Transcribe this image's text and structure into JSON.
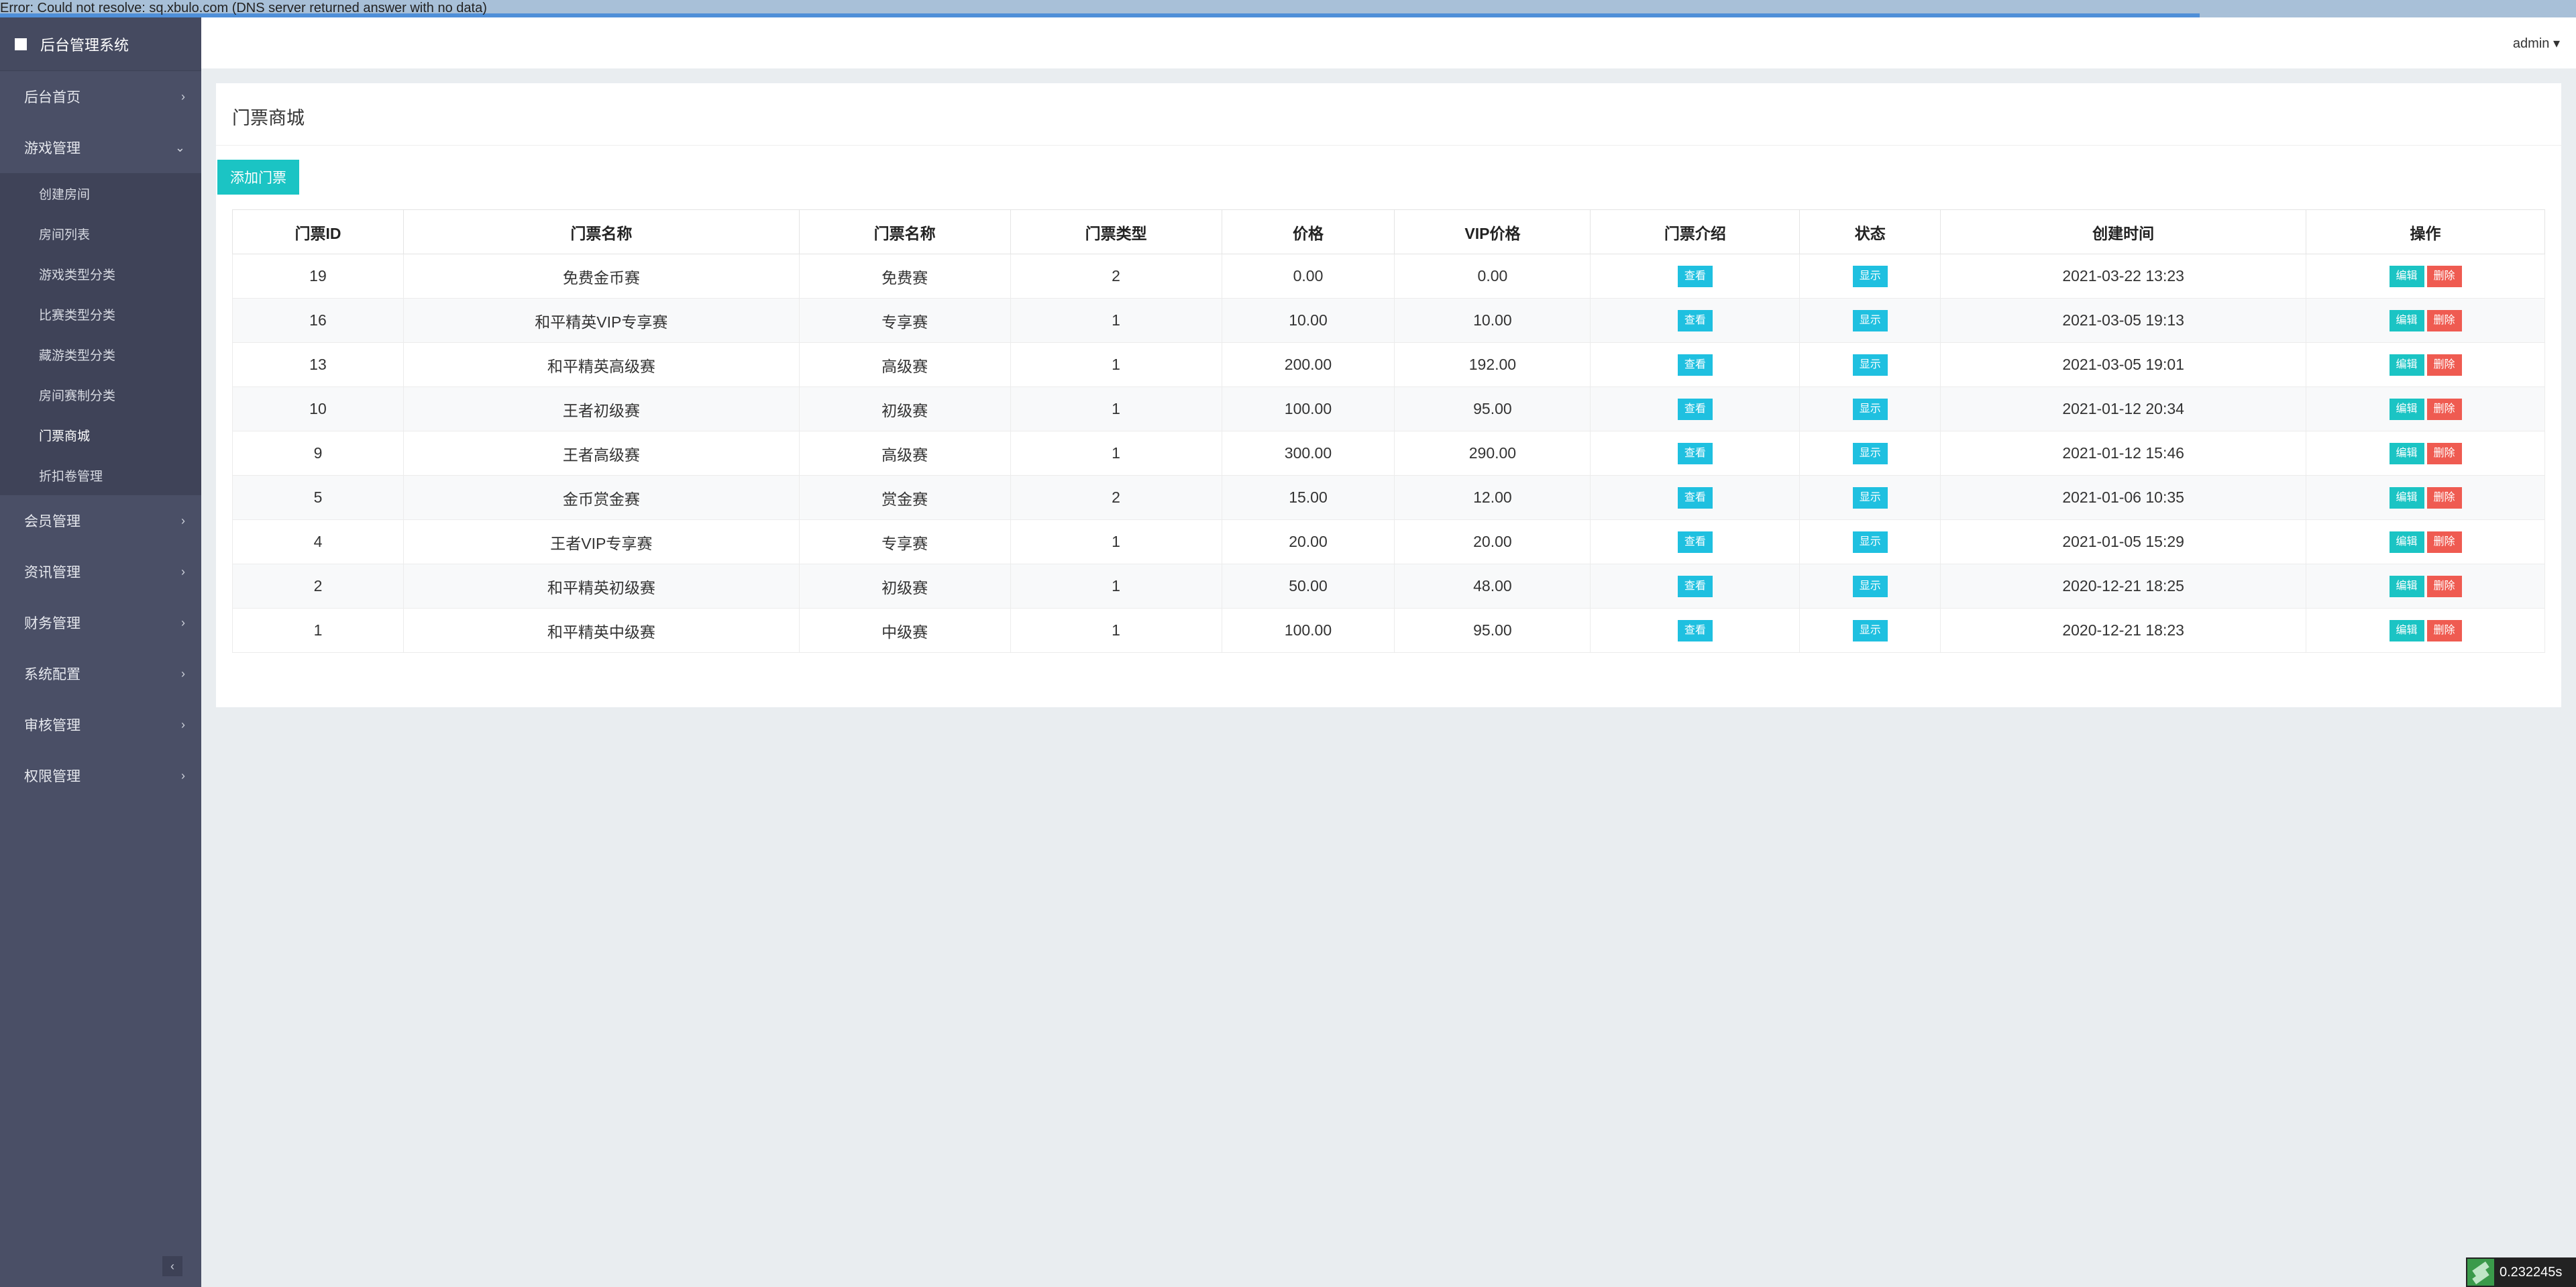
{
  "error_bar": {
    "text": "Error: Could not resolve: sq.xbulo.com (DNS server returned answer with no data)",
    "progress": 0.854
  },
  "brand": {
    "title": "后台管理系统"
  },
  "sidebar": {
    "items": [
      {
        "label": "后台首页",
        "chevron": "›"
      },
      {
        "label": "游戏管理",
        "chevron": "⌄"
      },
      {
        "label": "会员管理",
        "chevron": "›"
      },
      {
        "label": "资讯管理",
        "chevron": "›"
      },
      {
        "label": "财务管理",
        "chevron": "›"
      },
      {
        "label": "系统配置",
        "chevron": "›"
      },
      {
        "label": "审核管理",
        "chevron": "›"
      },
      {
        "label": "权限管理",
        "chevron": "›"
      }
    ],
    "game_submenu": [
      "创建房间",
      "房间列表",
      "游戏类型分类",
      "比赛类型分类",
      "藏游类型分类",
      "房间赛制分类",
      "门票商城",
      "折扣卷管理"
    ],
    "collapse_glyph": "‹"
  },
  "header": {
    "user": "admin ▾"
  },
  "panel": {
    "title": "门票商城",
    "add_button": "添加门票"
  },
  "table": {
    "headers": [
      "门票ID",
      "门票名称",
      "门票名称",
      "门票类型",
      "价格",
      "VIP价格",
      "门票介绍",
      "状态",
      "创建时间",
      "操作"
    ],
    "view_label": "查看",
    "status_label": "显示",
    "edit_label": "编辑",
    "delete_label": "删除",
    "rows": [
      {
        "id": "19",
        "name": "免费金币赛",
        "tier": "免费赛",
        "type": "2",
        "price": "0.00",
        "vip": "0.00",
        "created": "2021-03-22 13:23"
      },
      {
        "id": "16",
        "name": "和平精英VIP专享赛",
        "tier": "专享赛",
        "type": "1",
        "price": "10.00",
        "vip": "10.00",
        "created": "2021-03-05 19:13"
      },
      {
        "id": "13",
        "name": "和平精英高级赛",
        "tier": "高级赛",
        "type": "1",
        "price": "200.00",
        "vip": "192.00",
        "created": "2021-03-05 19:01"
      },
      {
        "id": "10",
        "name": "王者初级赛",
        "tier": "初级赛",
        "type": "1",
        "price": "100.00",
        "vip": "95.00",
        "created": "2021-01-12 20:34"
      },
      {
        "id": "9",
        "name": "王者高级赛",
        "tier": "高级赛",
        "type": "1",
        "price": "300.00",
        "vip": "290.00",
        "created": "2021-01-12 15:46"
      },
      {
        "id": "5",
        "name": "金币赏金赛",
        "tier": "赏金赛",
        "type": "2",
        "price": "15.00",
        "vip": "12.00",
        "created": "2021-01-06 10:35"
      },
      {
        "id": "4",
        "name": "王者VIP专享赛",
        "tier": "专享赛",
        "type": "1",
        "price": "20.00",
        "vip": "20.00",
        "created": "2021-01-05 15:29"
      },
      {
        "id": "2",
        "name": "和平精英初级赛",
        "tier": "初级赛",
        "type": "1",
        "price": "50.00",
        "vip": "48.00",
        "created": "2020-12-21 18:25"
      },
      {
        "id": "1",
        "name": "和平精英中级赛",
        "tier": "中级赛",
        "type": "1",
        "price": "100.00",
        "vip": "95.00",
        "created": "2020-12-21 18:23"
      }
    ]
  },
  "timer": {
    "value": "0.232245s"
  },
  "icons": {
    "brand": "square-icon",
    "timer": "leaf-logo-icon"
  },
  "colors": {
    "sidebar": "#4a4f66",
    "accent": "#1bc4c4",
    "info": "#1fc0e0",
    "danger": "#ef5b51"
  }
}
